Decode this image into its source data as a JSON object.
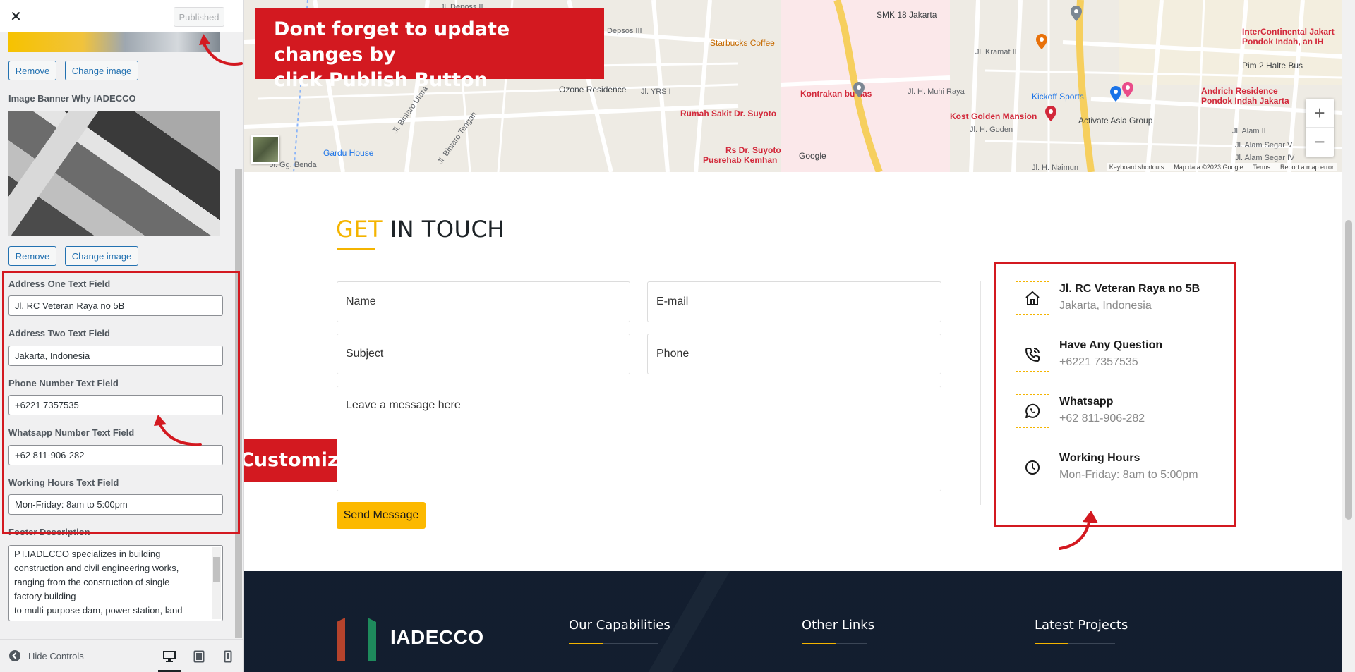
{
  "customizer": {
    "close_glyph": "✕",
    "publish_label": "Published",
    "remove_label": "Remove",
    "change_image_label": "Change image",
    "image_banner_label": "Image Banner Why IADECCO",
    "fields": {
      "address_one": {
        "label": "Address One Text Field",
        "value": "Jl. RC Veteran Raya no 5B"
      },
      "address_two": {
        "label": "Address Two Text Field",
        "value": "Jakarta, Indonesia"
      },
      "phone": {
        "label": "Phone Number Text Field",
        "value": "+6221 7357535"
      },
      "whatsapp": {
        "label": "Whatsapp Number Text Field",
        "value": "+62 811-906-282"
      },
      "hours": {
        "label": "Working Hours Text Field",
        "value": "Mon-Friday: 8am to 5:00pm"
      }
    },
    "footer_description": {
      "label": "Footer Description",
      "lines": [
        "PT.IADECCO specializes in building",
        "construction and civil engineering works,",
        "ranging from the construction of single",
        "factory building",
        "to multi-purpose dam, power station, land"
      ]
    },
    "hide_controls_label": "Hide Controls",
    "devices": [
      "desktop-icon",
      "tablet-icon",
      "mobile-icon"
    ]
  },
  "callouts": {
    "publish_tip": [
      "Dont forget to update changes by",
      "click Publish Button"
    ],
    "contact_tip": "Customize contact information"
  },
  "map": {
    "labels": {
      "jl_deposs_ii": "Jl. Deposs II",
      "smk18": "SMK 18 Jakarta",
      "intercontinental_1": "InterContinental Jakart",
      "intercontinental_2": "Pondok Indah, an IH",
      "starbucks": "Starbucks Coffee",
      "jl_depsos_iii": "Jl. Depsos III",
      "jl_kramat_ii": "Jl. Kramat II",
      "pim2": "Pim 2 Halte Bus",
      "ozone": "Ozone Residence",
      "jl_yrs": "Jl. YRS I",
      "kontrakan": "Kontrakan bu tias",
      "jl_muhi": "Jl. H. Muhi Raya",
      "kickoff": "Kickoff Sports",
      "andrich_1": "Andrich Residence",
      "andrich_2": "Pondok Indah Jakarta",
      "suyoto": "Rumah Sakit Dr. Suyoto",
      "kost": "Kost Golden Mansion",
      "activate": "Activate Asia Group",
      "goden": "Jl. H. Goden",
      "alam_ii": "Jl. Alam II",
      "gardu": "Gardu House",
      "rs_suyoto_1": "Rs Dr. Suyoto",
      "rs_suyoto_2": "Pusrehab Kemhan",
      "google": "Google",
      "jl_gg_benda": "Jl. Gg. Benda",
      "alam_sv": "Jl. Alam Segar V",
      "alam_siv": "Jl. Alam Segar IV",
      "naimun": "Jl. H. Naimun",
      "bintaro_utara": "Jl. Bintaro Utara",
      "bintaro_tengah": "Jl. Bintaro Tengah"
    },
    "attribution": [
      "Keyboard shortcuts",
      "Map data ©2023 Google",
      "Terms",
      "Report a map error"
    ],
    "zoom_in": "+",
    "zoom_out": "−"
  },
  "contact": {
    "title_highlight": "GET",
    "title_rest": "IN TOUCH",
    "placeholders": {
      "name": "Name",
      "email": "E-mail",
      "subject": "Subject",
      "phone": "Phone",
      "message": "Leave a message here"
    },
    "send_label": "Send Message",
    "info": [
      {
        "icon": "home-icon",
        "title": "Jl. RC Veteran Raya no 5B",
        "sub": "Jakarta, Indonesia"
      },
      {
        "icon": "phone-icon",
        "title": "Have Any Question",
        "sub": "+6221 7357535"
      },
      {
        "icon": "whatsapp-icon",
        "title": "Whatsapp",
        "sub": "+62 811-906-282"
      },
      {
        "icon": "clock-icon",
        "title": "Working Hours",
        "sub": "Mon-Friday: 8am to 5:00pm"
      }
    ]
  },
  "footer": {
    "logo_text": "IADECCO",
    "headings": [
      "Our Capabilities",
      "Other Links",
      "Latest Projects"
    ]
  },
  "colors": {
    "accent_yellow": "#f4b400",
    "annotation_red": "#d31920",
    "footer_bg": "#0e1a2b",
    "wp_blue": "#2271b1"
  }
}
